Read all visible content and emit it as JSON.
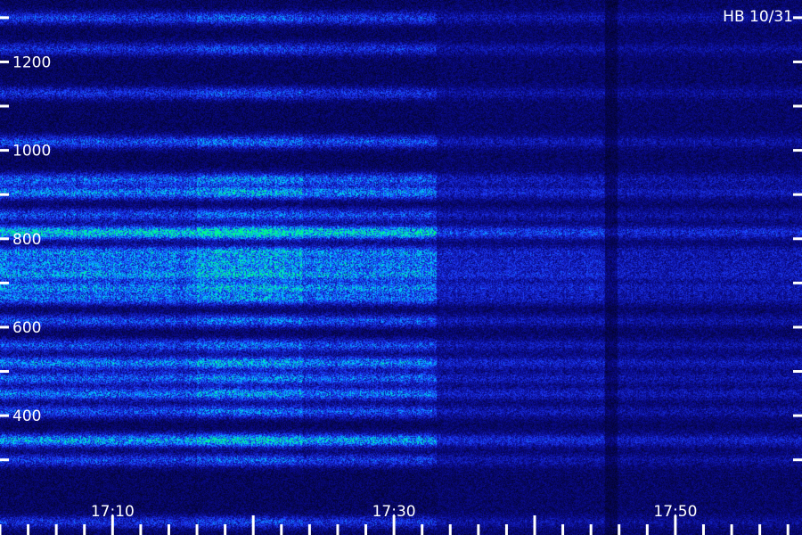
{
  "chart_data": {
    "type": "heatmap",
    "title": "HB 10/31",
    "xlabel": "",
    "ylabel": "",
    "x_range_minutes": [
      "17:02",
      "17:59"
    ],
    "x_tick_labels": [
      "17:10",
      "17:30",
      "17:50"
    ],
    "y_range": [
      130,
      1340
    ],
    "y_tick_labels": [
      "400",
      "600",
      "800",
      "1000",
      "1200"
    ],
    "colormap": [
      "#000000",
      "#0a0a8c",
      "#1e3cff",
      "#00c8ff",
      "#00ff80"
    ],
    "signal_end_time": "17:33",
    "dropout_time": "17:45",
    "bands": [
      {
        "freq": 1300,
        "intensity": 0.35
      },
      {
        "freq": 1230,
        "intensity": 0.3
      },
      {
        "freq": 1130,
        "intensity": 0.3
      },
      {
        "freq": 1020,
        "intensity": 0.4
      },
      {
        "freq": 935,
        "intensity": 0.45
      },
      {
        "freq": 905,
        "intensity": 0.55
      },
      {
        "freq": 855,
        "intensity": 0.4
      },
      {
        "freq": 815,
        "intensity": 0.85
      },
      {
        "freq": 770,
        "intensity": 0.55
      },
      {
        "freq": 745,
        "intensity": 0.5
      },
      {
        "freq": 720,
        "intensity": 0.6
      },
      {
        "freq": 690,
        "intensity": 0.55
      },
      {
        "freq": 665,
        "intensity": 0.45
      },
      {
        "freq": 615,
        "intensity": 0.4
      },
      {
        "freq": 560,
        "intensity": 0.4
      },
      {
        "freq": 520,
        "intensity": 0.55
      },
      {
        "freq": 485,
        "intensity": 0.45
      },
      {
        "freq": 450,
        "intensity": 0.5
      },
      {
        "freq": 410,
        "intensity": 0.4
      },
      {
        "freq": 345,
        "intensity": 0.65
      },
      {
        "freq": 300,
        "intensity": 0.35
      },
      {
        "freq": 160,
        "intensity": 0.3
      }
    ]
  }
}
